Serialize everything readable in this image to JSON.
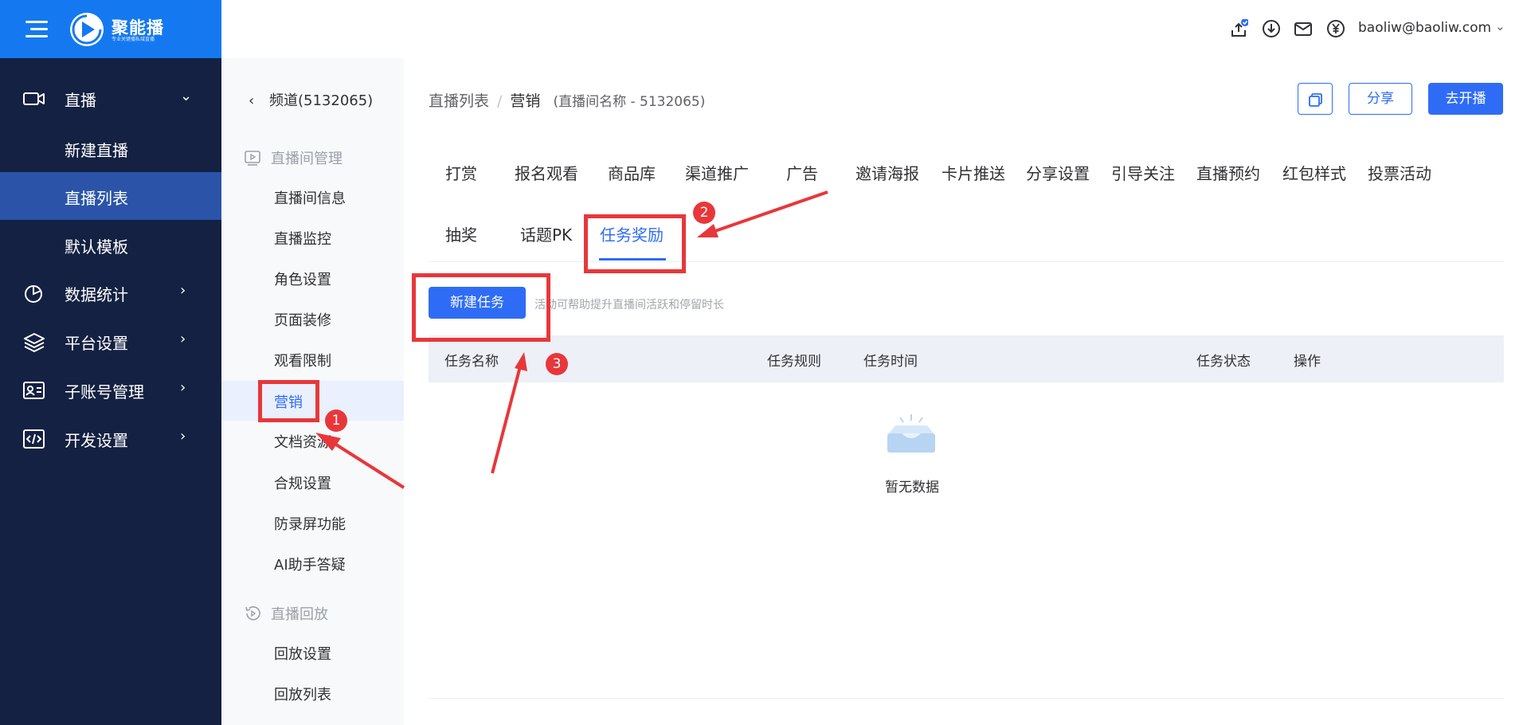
{
  "brand": {
    "name": "聚能播",
    "tagline": "专业关键播私域直播"
  },
  "nav": {
    "items": [
      {
        "label": "直播",
        "icon": "video-camera-icon",
        "expanded": true
      },
      {
        "label": "数据统计",
        "icon": "pie-chart-icon"
      },
      {
        "label": "平台设置",
        "icon": "layers-icon"
      },
      {
        "label": "子账号管理",
        "icon": "id-card-icon"
      },
      {
        "label": "开发设置",
        "icon": "code-icon"
      }
    ],
    "live_sub": [
      "新建直播",
      "直播列表",
      "默认模板"
    ],
    "active_sub": "直播列表"
  },
  "header": {
    "icons": [
      "upload-icon",
      "download-icon",
      "mail-icon",
      "yen-icon"
    ],
    "user_email": "baoliw@baoliw.com"
  },
  "subnav": {
    "back_label": "频道(5132065)",
    "groups": [
      {
        "label": "直播间管理",
        "icon": "play-square-icon",
        "items": [
          "直播间信息",
          "直播监控",
          "角色设置",
          "页面装修",
          "观看限制",
          "营销",
          "文档资源",
          "合规设置",
          "防录屏功能",
          "AI助手答疑"
        ]
      },
      {
        "label": "直播回放",
        "icon": "history-icon",
        "items": [
          "回放设置",
          "回放列表"
        ]
      }
    ],
    "active_item": "营销"
  },
  "breadcrumb": {
    "list": "直播列表",
    "separator": "/",
    "current": "营销",
    "room": "(直播间名称 - 5132065)"
  },
  "actions": {
    "copy_icon": "copy-icon",
    "share": "分享",
    "go_live": "去开播"
  },
  "tabs": {
    "row1": [
      "打赏",
      "报名观看",
      "商品库",
      "渠道推广",
      "广告",
      "邀请海报",
      "卡片推送",
      "分享设置",
      "引导关注",
      "直播预约",
      "红包样式",
      "投票活动"
    ],
    "row2": [
      "抽奖",
      "话题PK",
      "任务奖励"
    ],
    "active": "任务奖励"
  },
  "task_panel": {
    "new_task_button": "新建任务",
    "hint": "活动可帮助提升直播间活跃和停留时长",
    "columns": [
      "任务名称",
      "任务规则",
      "任务时间",
      "任务状态",
      "操作"
    ],
    "empty_text": "暂无数据"
  },
  "annotations": {
    "badges": [
      "1",
      "2",
      "3"
    ],
    "color": "#e8373a"
  },
  "colors": {
    "primary": "#2f6cf6",
    "nav_bg": "#142142",
    "logo_bar": "#1479f0"
  }
}
